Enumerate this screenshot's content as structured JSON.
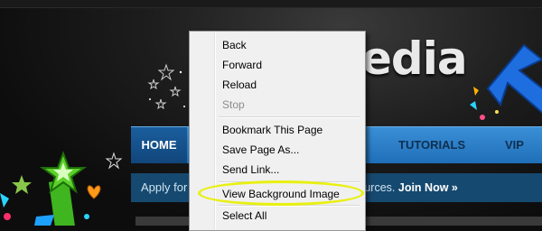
{
  "site": {
    "logo_text": "edia",
    "nav": {
      "home": "HOME",
      "tutorials": "TUTORIALS",
      "vip": "VIP DO"
    },
    "banner": {
      "left_text": "Apply for",
      "right_text": "r VIP resources.",
      "join_label": "Join Now »"
    }
  },
  "context_menu": {
    "items": [
      {
        "label": "Back",
        "enabled": true
      },
      {
        "label": "Forward",
        "enabled": true
      },
      {
        "label": "Reload",
        "enabled": true
      },
      {
        "label": "Stop",
        "enabled": false
      },
      {
        "label": "Bookmark This Page",
        "enabled": true
      },
      {
        "label": "Save Page As...",
        "enabled": true
      },
      {
        "label": "Send Link...",
        "enabled": true
      },
      {
        "label": "View Background Image",
        "enabled": true
      },
      {
        "label": "Select All",
        "enabled": true
      }
    ],
    "highlighted_item": "View Background Image"
  },
  "colors": {
    "nav_blue": "#2a7fca",
    "home_tab": "#11467a",
    "banner_bg": "#16496f",
    "menu_bg": "#f0f0f0",
    "highlight_ring": "#e8f011"
  }
}
